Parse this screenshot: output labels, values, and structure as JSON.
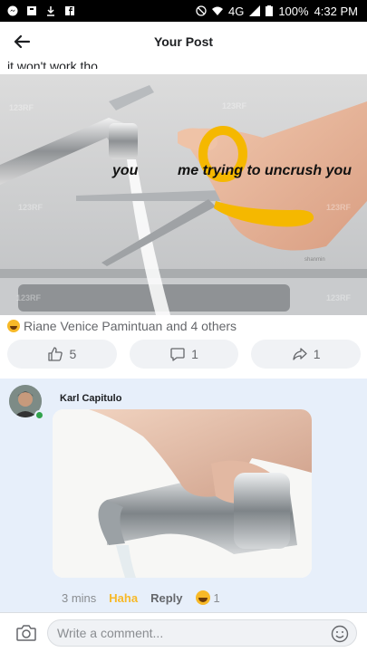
{
  "statusbar": {
    "network": "4G",
    "battery": "100%",
    "time": "4:32 PM"
  },
  "header": {
    "title": "Your Post"
  },
  "post": {
    "text": "it won't work tho",
    "meme": {
      "label_left": "you",
      "label_right": "me trying to uncrush you",
      "watermark": "123RF",
      "credit": "shanmin"
    },
    "reactions_text": "Riane Venice Pamintuan and 4 others",
    "like_count": "5",
    "comment_count": "1",
    "share_count": "1"
  },
  "comment": {
    "author": "Karl Capitulo",
    "time": "3 mins",
    "reaction_label": "Haha",
    "reply_label": "Reply",
    "reaction_count": "1"
  },
  "composer": {
    "placeholder": "Write a comment..."
  },
  "colors": {
    "haha": "#f7b928",
    "online": "#31a24c",
    "comment_bg": "#e7effa"
  }
}
